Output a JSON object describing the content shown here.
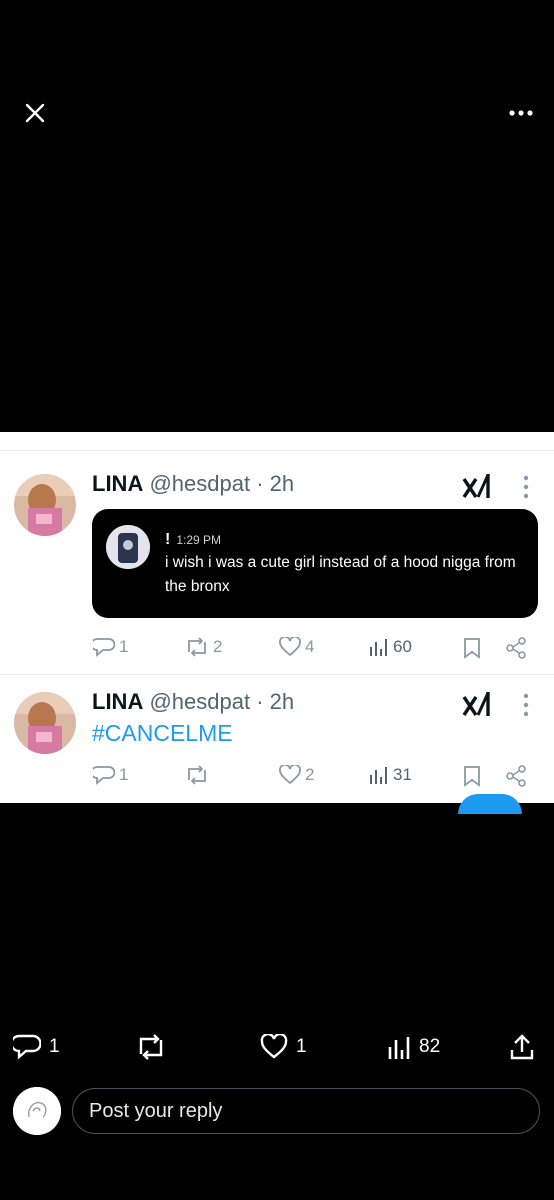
{
  "viewer": {
    "close_icon": "close-icon",
    "more_icon": "more-horizontal-icon"
  },
  "tweets": [
    {
      "display_name": "LINA",
      "handle_time": "@hesdpat · 2h",
      "quote": {
        "mark": "!",
        "time": "1:29 PM",
        "text": "i wish i was a cute girl instead of a hood nigga from the bronx"
      },
      "actions": {
        "replies": "1",
        "retweets": "2",
        "likes": "4",
        "views": "60"
      }
    },
    {
      "display_name": "LINA",
      "handle_time": "@hesdpat · 2h",
      "hashtag": "#CANCELME",
      "actions": {
        "replies": "1",
        "retweets": "",
        "likes": "2",
        "views": "31"
      }
    }
  ],
  "post_actions": {
    "replies": "1",
    "likes": "1",
    "views": "82"
  },
  "reply": {
    "placeholder": "Post your reply"
  },
  "colors": {
    "accent": "#1d9bf0",
    "muted": "#536471",
    "background": "#000000"
  }
}
